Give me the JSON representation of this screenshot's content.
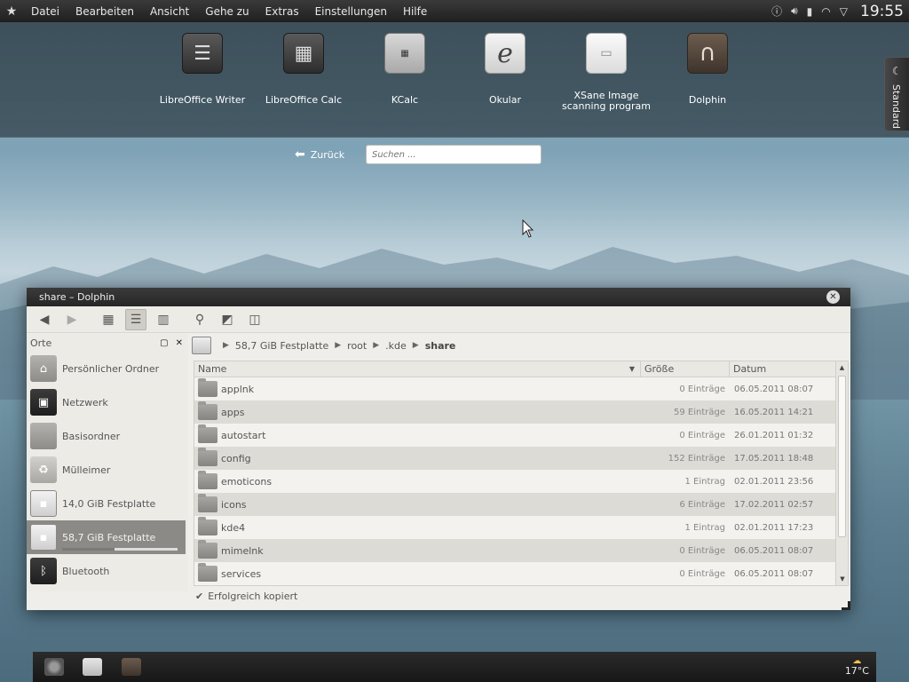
{
  "menubar": {
    "items": [
      "Datei",
      "Bearbeiten",
      "Ansicht",
      "Gehe zu",
      "Extras",
      "Einstellungen",
      "Hilfe"
    ],
    "clock": "19:55"
  },
  "launcher": {
    "apps": [
      {
        "label": "LibreOffice Writer"
      },
      {
        "label": "LibreOffice Calc"
      },
      {
        "label": "KCalc"
      },
      {
        "label": "Okular"
      },
      {
        "label": "XSane Image scanning program"
      },
      {
        "label": "Dolphin"
      }
    ],
    "side_tab": "Standard",
    "back_label": "Zurück",
    "search_placeholder": "Suchen ..."
  },
  "window": {
    "title": "share – Dolphin",
    "places_header": "Orte",
    "places": [
      {
        "label": "Persönlicher Ordner",
        "icon": "home-folder-icon"
      },
      {
        "label": "Netzwerk",
        "icon": "network-icon"
      },
      {
        "label": "Basisordner",
        "icon": "folder-icon"
      },
      {
        "label": "Mülleimer",
        "icon": "trash-icon"
      },
      {
        "label": "14,0 GiB Festplatte",
        "icon": "hard-disk-icon"
      },
      {
        "label": "58,7 GiB Festplatte",
        "icon": "hard-disk-icon",
        "selected": true,
        "usage": 0.45
      },
      {
        "label": "Bluetooth",
        "icon": "bluetooth-icon"
      }
    ],
    "breadcrumb": [
      "58,7 GiB Festplatte",
      "root",
      ".kde",
      "share"
    ],
    "columns": {
      "name": "Name",
      "size": "Größe",
      "date": "Datum"
    },
    "files": [
      {
        "name": "applnk",
        "size": "0 Einträge",
        "date": "06.05.2011 08:07"
      },
      {
        "name": "apps",
        "size": "59 Einträge",
        "date": "16.05.2011 14:21"
      },
      {
        "name": "autostart",
        "size": "0 Einträge",
        "date": "26.01.2011 01:32"
      },
      {
        "name": "config",
        "size": "152 Einträge",
        "date": "17.05.2011 18:48"
      },
      {
        "name": "emoticons",
        "size": "1 Eintrag",
        "date": "02.01.2011 23:56"
      },
      {
        "name": "icons",
        "size": "6 Einträge",
        "date": "17.02.2011 02:57"
      },
      {
        "name": "kde4",
        "size": "1 Eintrag",
        "date": "02.01.2011 17:23"
      },
      {
        "name": "mimelnk",
        "size": "0 Einträge",
        "date": "06.05.2011 08:07"
      },
      {
        "name": "services",
        "size": "0 Einträge",
        "date": "06.05.2011 08:07"
      }
    ],
    "status": "Erfolgreich kopiert"
  },
  "taskbar": {
    "weather": "17°C"
  }
}
